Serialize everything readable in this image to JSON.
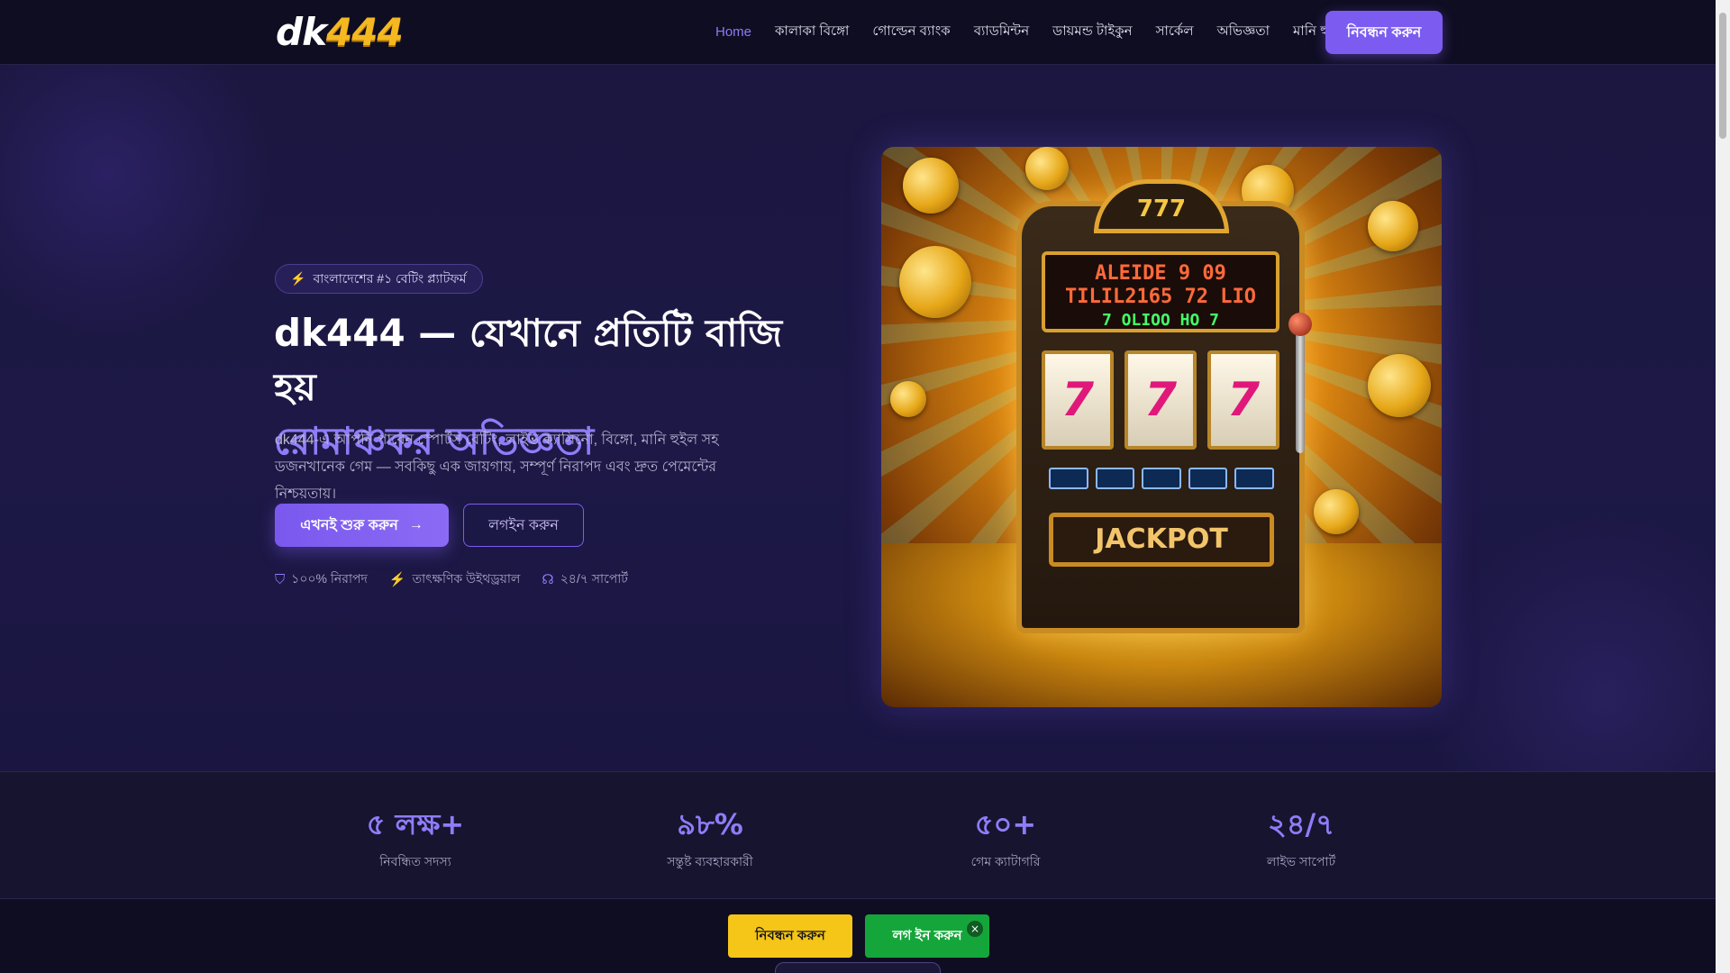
{
  "header": {
    "logo": {
      "dk": "dk",
      "num": "444"
    },
    "nav": [
      {
        "label": "Home",
        "active": true
      },
      {
        "label": "কালাকা বিঙ্গো"
      },
      {
        "label": "গোল্ডেন ব্যাংক"
      },
      {
        "label": "ব্যাডমিন্টন"
      },
      {
        "label": "ডায়মন্ড টাইকুন"
      },
      {
        "label": "সার্কেল"
      },
      {
        "label": "অভিজ্ঞতা"
      },
      {
        "label": "মানি হুইল"
      }
    ],
    "register_label": "নিবন্ধন করুন"
  },
  "hero": {
    "badge": "বাংলাদেশের #১ বেটিং প্ল্যাটফর্ম",
    "title_line1": "dk444 — যেখানে প্রতিটি বাজি হয়",
    "title_line2": "রোমাঞ্চকর অভিজ্ঞতা",
    "description": "dk444-এ আপনি পাবেন স্পোর্টস বেটিং, লাইভ ক্যাসিনো, বিঙ্গো, মানি হুইল সহ ডজনখানেক গেম — সবকিছু এক জায়গায়, সম্পূর্ণ নিরাপদ এবং দ্রুত পেমেন্টের নিশ্চয়তায়।",
    "start_label": "এখনই শুরু করুন",
    "login_label": "লগইন করুন",
    "features": [
      {
        "icon": "shield-icon",
        "label": "১০০% নিরাপদ"
      },
      {
        "icon": "bolt-icon",
        "label": "তাৎক্ষণিক উইথড্রয়াল"
      },
      {
        "icon": "headset-icon",
        "label": "২৪/৭ সাপোর্ট"
      }
    ],
    "image": {
      "top_sign": "777",
      "marquee_line1": "ALEIDE 9 09",
      "marquee_line2": "TILIL2165 72 LIO",
      "marquee_line3": "7 OLIOO HO 7",
      "reel_symbol": "7",
      "jackpot": "JACKPOT"
    }
  },
  "stats": [
    {
      "value": "৫ লক্ষ+",
      "label": "নিবন্ধিত সদস্য"
    },
    {
      "value": "৯৮%",
      "label": "সন্তুষ্ট ব্যবহারকারী"
    },
    {
      "value": "৫০+",
      "label": "গেম ক্যাটাগরি"
    },
    {
      "value": "২৪/৭",
      "label": "লাইভ সাপোর্ট"
    }
  ],
  "bottom_bar": {
    "register_label": "নিবন্ধন করুন",
    "login_label": "লগ ইন করুন",
    "close": "×"
  },
  "colors": {
    "accent": "#7c5cf0",
    "accent_text": "#8f7cf8",
    "bottom_register": "#f5c518",
    "bottom_login": "#14a63a"
  }
}
